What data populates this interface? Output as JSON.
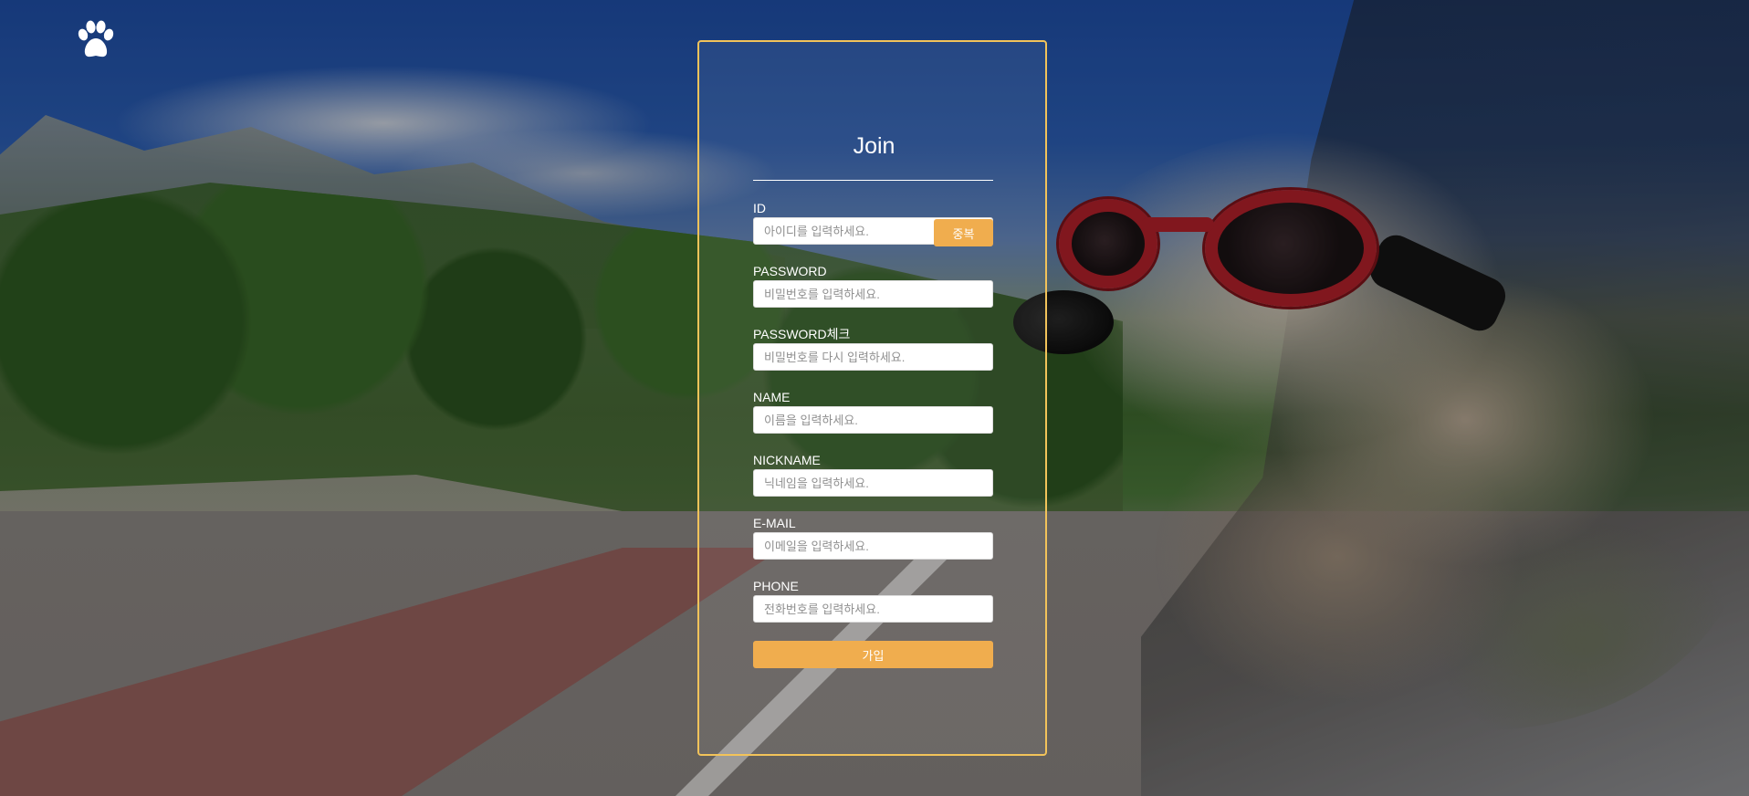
{
  "brand": {
    "logo_icon": "paw-icon"
  },
  "form": {
    "title": "Join",
    "fields": [
      {
        "key": "id",
        "label": "ID",
        "placeholder": "아이디를 입력하세요.",
        "value": ""
      },
      {
        "key": "password",
        "label": "PASSWORD",
        "placeholder": "비밀번호를 입력하세요.",
        "value": ""
      },
      {
        "key": "password_check",
        "label": "PASSWORD체크",
        "placeholder": "비밀번호를 다시 입력하세요.",
        "value": ""
      },
      {
        "key": "name",
        "label": "NAME",
        "placeholder": "이름을 입력하세요.",
        "value": ""
      },
      {
        "key": "nickname",
        "label": "NICKNAME",
        "placeholder": "닉네임을 입력하세요.",
        "value": ""
      },
      {
        "key": "email",
        "label": "E-MAIL",
        "placeholder": "이메일을 입력하세요.",
        "value": ""
      },
      {
        "key": "phone",
        "label": "PHONE",
        "placeholder": "전화번호를 입력하세요.",
        "value": ""
      }
    ],
    "duplicate_check_label": "중복",
    "submit_label": "가입"
  },
  "colors": {
    "accent": "#f0ad4e",
    "panel_border": "#f2c35a",
    "text": "#ffffff"
  }
}
